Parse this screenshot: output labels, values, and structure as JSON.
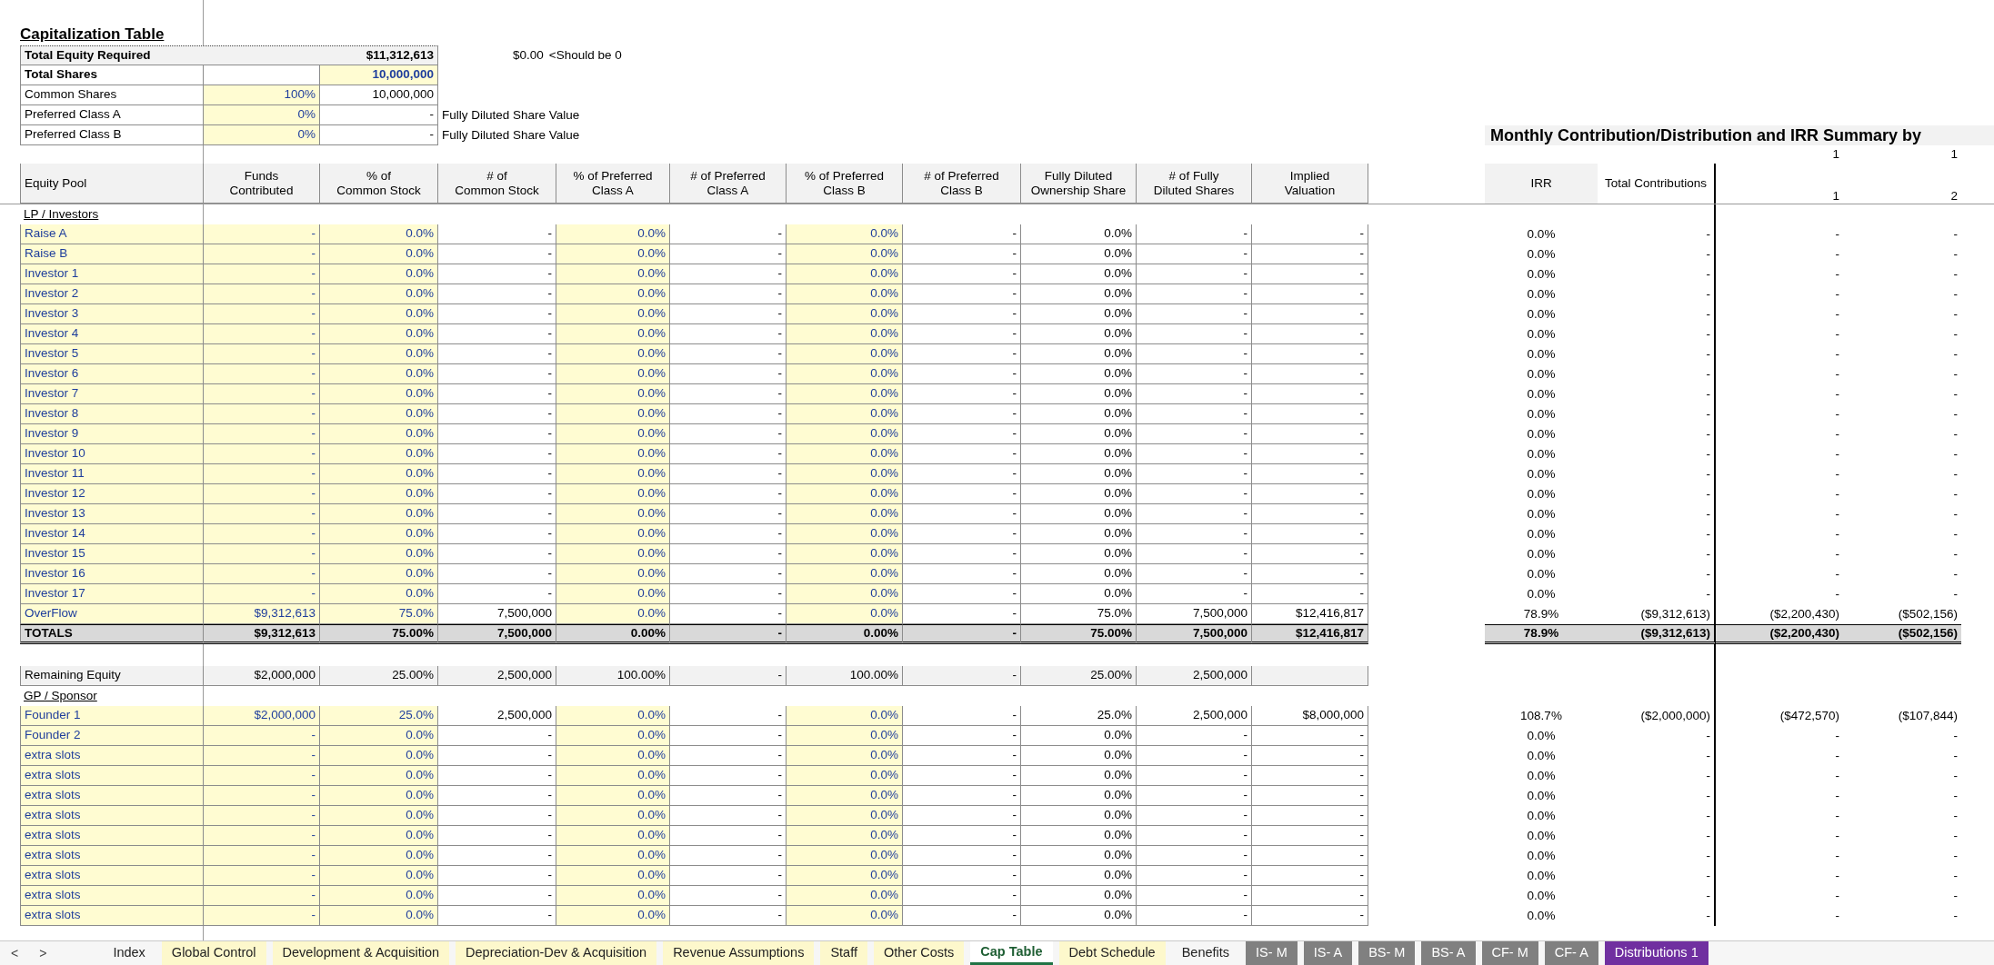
{
  "title": "Capitalization Table",
  "summary": [
    {
      "kind": "required",
      "label": "Total Equity Required",
      "value": "$11,312,613",
      "check": "$0.00",
      "note": "<Should be 0"
    },
    {
      "kind": "shares",
      "label": "Total Shares",
      "value": "10,000,000"
    },
    {
      "kind": "class",
      "label": "Common Shares",
      "share": "100%",
      "value": "10,000,000"
    },
    {
      "kind": "class",
      "label": "Preferred Class A",
      "share": "0%",
      "value": "-",
      "note": "Fully Diluted Share Value"
    },
    {
      "kind": "class",
      "label": "Preferred Class B",
      "share": "0%",
      "value": "-",
      "note": "Fully Diluted Share Value"
    }
  ],
  "monthly": {
    "title": "Monthly Contribution/Distribution and IRR Summary by",
    "groups": [
      "1",
      "1"
    ],
    "headers": [
      "IRR",
      "Total Contributions",
      "1",
      "2"
    ]
  },
  "pool_header": "Equity Pool",
  "columns": [
    {
      "label": "Funds Contributed",
      "input": true
    },
    {
      "label": "% of Common Stock",
      "input": true
    },
    {
      "label": "# of Common Stock",
      "input": false
    },
    {
      "label": "% of Preferred Class A",
      "input": true
    },
    {
      "label": "# of Preferred Class A",
      "input": false
    },
    {
      "label": "% of Preferred Class B",
      "input": true
    },
    {
      "label": "# of Preferred Class B",
      "input": false
    },
    {
      "label": "Fully Diluted Ownership Share",
      "input": false
    },
    {
      "label": "# of Fully Diluted Shares",
      "input": false
    },
    {
      "label": "Implied Valuation",
      "input": false
    }
  ],
  "lp": {
    "label": "LP / Investors",
    "rows": [
      {
        "name": "Raise A",
        "cells": [
          "-",
          "0.0%",
          "-",
          "0.0%",
          "-",
          "0.0%",
          "-",
          "0.0%",
          "-",
          "-"
        ],
        "summary": [
          "0.0%",
          "-",
          "-",
          "-"
        ]
      },
      {
        "name": "Raise B",
        "cells": [
          "-",
          "0.0%",
          "-",
          "0.0%",
          "-",
          "0.0%",
          "-",
          "0.0%",
          "-",
          "-"
        ],
        "summary": [
          "0.0%",
          "-",
          "-",
          "-"
        ]
      },
      {
        "name": "Investor 1",
        "cells": [
          "-",
          "0.0%",
          "-",
          "0.0%",
          "-",
          "0.0%",
          "-",
          "0.0%",
          "-",
          "-"
        ],
        "summary": [
          "0.0%",
          "-",
          "-",
          "-"
        ]
      },
      {
        "name": "Investor 2",
        "cells": [
          "-",
          "0.0%",
          "-",
          "0.0%",
          "-",
          "0.0%",
          "-",
          "0.0%",
          "-",
          "-"
        ],
        "summary": [
          "0.0%",
          "-",
          "-",
          "-"
        ]
      },
      {
        "name": "Investor 3",
        "cells": [
          "-",
          "0.0%",
          "-",
          "0.0%",
          "-",
          "0.0%",
          "-",
          "0.0%",
          "-",
          "-"
        ],
        "summary": [
          "0.0%",
          "-",
          "-",
          "-"
        ]
      },
      {
        "name": "Investor 4",
        "cells": [
          "-",
          "0.0%",
          "-",
          "0.0%",
          "-",
          "0.0%",
          "-",
          "0.0%",
          "-",
          "-"
        ],
        "summary": [
          "0.0%",
          "-",
          "-",
          "-"
        ]
      },
      {
        "name": "Investor 5",
        "cells": [
          "-",
          "0.0%",
          "-",
          "0.0%",
          "-",
          "0.0%",
          "-",
          "0.0%",
          "-",
          "-"
        ],
        "summary": [
          "0.0%",
          "-",
          "-",
          "-"
        ]
      },
      {
        "name": "Investor 6",
        "cells": [
          "-",
          "0.0%",
          "-",
          "0.0%",
          "-",
          "0.0%",
          "-",
          "0.0%",
          "-",
          "-"
        ],
        "summary": [
          "0.0%",
          "-",
          "-",
          "-"
        ]
      },
      {
        "name": "Investor 7",
        "cells": [
          "-",
          "0.0%",
          "-",
          "0.0%",
          "-",
          "0.0%",
          "-",
          "0.0%",
          "-",
          "-"
        ],
        "summary": [
          "0.0%",
          "-",
          "-",
          "-"
        ]
      },
      {
        "name": "Investor 8",
        "cells": [
          "-",
          "0.0%",
          "-",
          "0.0%",
          "-",
          "0.0%",
          "-",
          "0.0%",
          "-",
          "-"
        ],
        "summary": [
          "0.0%",
          "-",
          "-",
          "-"
        ]
      },
      {
        "name": "Investor 9",
        "cells": [
          "-",
          "0.0%",
          "-",
          "0.0%",
          "-",
          "0.0%",
          "-",
          "0.0%",
          "-",
          "-"
        ],
        "summary": [
          "0.0%",
          "-",
          "-",
          "-"
        ]
      },
      {
        "name": "Investor 10",
        "cells": [
          "-",
          "0.0%",
          "-",
          "0.0%",
          "-",
          "0.0%",
          "-",
          "0.0%",
          "-",
          "-"
        ],
        "summary": [
          "0.0%",
          "-",
          "-",
          "-"
        ]
      },
      {
        "name": "Investor 11",
        "cells": [
          "-",
          "0.0%",
          "-",
          "0.0%",
          "-",
          "0.0%",
          "-",
          "0.0%",
          "-",
          "-"
        ],
        "summary": [
          "0.0%",
          "-",
          "-",
          "-"
        ]
      },
      {
        "name": "Investor 12",
        "cells": [
          "-",
          "0.0%",
          "-",
          "0.0%",
          "-",
          "0.0%",
          "-",
          "0.0%",
          "-",
          "-"
        ],
        "summary": [
          "0.0%",
          "-",
          "-",
          "-"
        ]
      },
      {
        "name": "Investor 13",
        "cells": [
          "-",
          "0.0%",
          "-",
          "0.0%",
          "-",
          "0.0%",
          "-",
          "0.0%",
          "-",
          "-"
        ],
        "summary": [
          "0.0%",
          "-",
          "-",
          "-"
        ]
      },
      {
        "name": "Investor 14",
        "cells": [
          "-",
          "0.0%",
          "-",
          "0.0%",
          "-",
          "0.0%",
          "-",
          "0.0%",
          "-",
          "-"
        ],
        "summary": [
          "0.0%",
          "-",
          "-",
          "-"
        ]
      },
      {
        "name": "Investor 15",
        "cells": [
          "-",
          "0.0%",
          "-",
          "0.0%",
          "-",
          "0.0%",
          "-",
          "0.0%",
          "-",
          "-"
        ],
        "summary": [
          "0.0%",
          "-",
          "-",
          "-"
        ]
      },
      {
        "name": "Investor 16",
        "cells": [
          "-",
          "0.0%",
          "-",
          "0.0%",
          "-",
          "0.0%",
          "-",
          "0.0%",
          "-",
          "-"
        ],
        "summary": [
          "0.0%",
          "-",
          "-",
          "-"
        ]
      },
      {
        "name": "Investor 17",
        "cells": [
          "-",
          "0.0%",
          "-",
          "0.0%",
          "-",
          "0.0%",
          "-",
          "0.0%",
          "-",
          "-"
        ],
        "summary": [
          "0.0%",
          "-",
          "-",
          "-"
        ]
      },
      {
        "name": "OverFlow",
        "cells": [
          "$9,312,613",
          "75.0%",
          "7,500,000",
          "0.0%",
          "-",
          "0.0%",
          "-",
          "75.0%",
          "7,500,000",
          "$12,416,817"
        ],
        "summary": [
          "78.9%",
          "($9,312,613)",
          "($2,200,430)",
          "($502,156)"
        ]
      }
    ],
    "totals": {
      "name": "TOTALS",
      "cells": [
        "$9,312,613",
        "75.00%",
        "7,500,000",
        "0.00%",
        "-",
        "0.00%",
        "-",
        "75.00%",
        "7,500,000",
        "$12,416,817"
      ],
      "summary": [
        "78.9%",
        "($9,312,613)",
        "($2,200,430)",
        "($502,156)"
      ]
    }
  },
  "remaining": {
    "name": "Remaining Equity",
    "cells": [
      "$2,000,000",
      "25.00%",
      "2,500,000",
      "100.00%",
      "-",
      "100.00%",
      "-",
      "25.00%",
      "2,500,000"
    ]
  },
  "gp": {
    "label": "GP / Sponsor",
    "rows": [
      {
        "name": "Founder 1",
        "cells": [
          "$2,000,000",
          "25.0%",
          "2,500,000",
          "0.0%",
          "-",
          "0.0%",
          "-",
          "25.0%",
          "2,500,000",
          "$8,000,000"
        ],
        "summary": [
          "108.7%",
          "($2,000,000)",
          "($472,570)",
          "($107,844)"
        ]
      },
      {
        "name": "Founder 2",
        "cells": [
          "-",
          "0.0%",
          "-",
          "0.0%",
          "-",
          "0.0%",
          "-",
          "0.0%",
          "-",
          "-"
        ],
        "summary": [
          "0.0%",
          "-",
          "-",
          "-"
        ]
      },
      {
        "name": "extra slots",
        "cells": [
          "-",
          "0.0%",
          "-",
          "0.0%",
          "-",
          "0.0%",
          "-",
          "0.0%",
          "-",
          "-"
        ],
        "summary": [
          "0.0%",
          "-",
          "-",
          "-"
        ]
      },
      {
        "name": "extra slots",
        "cells": [
          "-",
          "0.0%",
          "-",
          "0.0%",
          "-",
          "0.0%",
          "-",
          "0.0%",
          "-",
          "-"
        ],
        "summary": [
          "0.0%",
          "-",
          "-",
          "-"
        ]
      },
      {
        "name": "extra slots",
        "cells": [
          "-",
          "0.0%",
          "-",
          "0.0%",
          "-",
          "0.0%",
          "-",
          "0.0%",
          "-",
          "-"
        ],
        "summary": [
          "0.0%",
          "-",
          "-",
          "-"
        ]
      },
      {
        "name": "extra slots",
        "cells": [
          "-",
          "0.0%",
          "-",
          "0.0%",
          "-",
          "0.0%",
          "-",
          "0.0%",
          "-",
          "-"
        ],
        "summary": [
          "0.0%",
          "-",
          "-",
          "-"
        ]
      },
      {
        "name": "extra slots",
        "cells": [
          "-",
          "0.0%",
          "-",
          "0.0%",
          "-",
          "0.0%",
          "-",
          "0.0%",
          "-",
          "-"
        ],
        "summary": [
          "0.0%",
          "-",
          "-",
          "-"
        ]
      },
      {
        "name": "extra slots",
        "cells": [
          "-",
          "0.0%",
          "-",
          "0.0%",
          "-",
          "0.0%",
          "-",
          "0.0%",
          "-",
          "-"
        ],
        "summary": [
          "0.0%",
          "-",
          "-",
          "-"
        ]
      },
      {
        "name": "extra slots",
        "cells": [
          "-",
          "0.0%",
          "-",
          "0.0%",
          "-",
          "0.0%",
          "-",
          "0.0%",
          "-",
          "-"
        ],
        "summary": [
          "0.0%",
          "-",
          "-",
          "-"
        ]
      },
      {
        "name": "extra slots",
        "cells": [
          "-",
          "0.0%",
          "-",
          "0.0%",
          "-",
          "0.0%",
          "-",
          "0.0%",
          "-",
          "-"
        ],
        "summary": [
          "0.0%",
          "-",
          "-",
          "-"
        ]
      },
      {
        "name": "extra slots",
        "cells": [
          "-",
          "0.0%",
          "-",
          "0.0%",
          "-",
          "0.0%",
          "-",
          "0.0%",
          "-",
          "-"
        ],
        "summary": [
          "0.0%",
          "-",
          "-",
          "-"
        ]
      }
    ]
  },
  "nav": [
    "<",
    ">"
  ],
  "tabs": [
    {
      "label": "Index",
      "selected": false
    },
    {
      "label": "Global Control",
      "selected": false,
      "color": "#fdf8cc"
    },
    {
      "label": "Development & Acquisition",
      "selected": false,
      "color": "#fdf8cc"
    },
    {
      "label": "Depreciation-Dev & Acquisition",
      "selected": false,
      "color": "#fdf8cc"
    },
    {
      "label": "Revenue Assumptions",
      "selected": false,
      "color": "#fdf8cc"
    },
    {
      "label": "Staff",
      "selected": false,
      "color": "#fdf8cc"
    },
    {
      "label": "Other Costs",
      "selected": false,
      "color": "#fdf8cc"
    },
    {
      "label": "Cap Table",
      "selected": true
    },
    {
      "label": "Debt Schedule",
      "selected": false,
      "color": "#fdf8cc"
    },
    {
      "label": "Benefits",
      "selected": false
    },
    {
      "label": "IS- M",
      "selected": false,
      "color": "#808080"
    },
    {
      "label": "IS- A",
      "selected": false,
      "color": "#808080"
    },
    {
      "label": "BS- M",
      "selected": false,
      "color": "#808080"
    },
    {
      "label": "BS- A",
      "selected": false,
      "color": "#808080"
    },
    {
      "label": "CF- M",
      "selected": false,
      "color": "#808080"
    },
    {
      "label": "CF- A",
      "selected": false,
      "color": "#808080"
    },
    {
      "label": "Distributions 1",
      "selected": false,
      "color": "#7030a0"
    }
  ]
}
